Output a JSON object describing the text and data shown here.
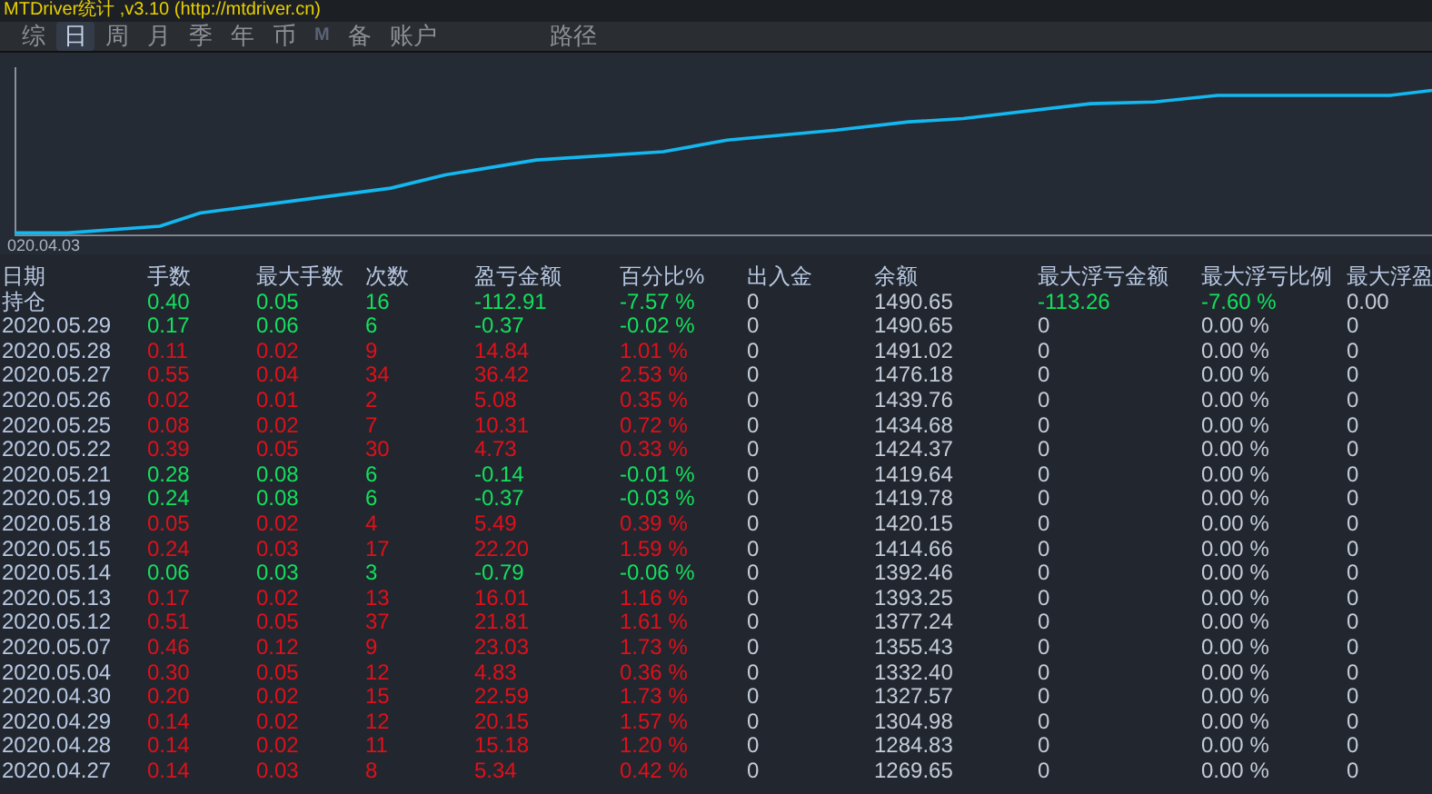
{
  "window": {
    "title": "MTDriver统计 ,v3.10 (http://mtdriver.cn)"
  },
  "tabs": [
    {
      "label": "综",
      "selected": false,
      "disabled": false
    },
    {
      "label": "日",
      "selected": true,
      "disabled": false
    },
    {
      "label": "周",
      "selected": false,
      "disabled": false
    },
    {
      "label": "月",
      "selected": false,
      "disabled": false
    },
    {
      "label": "季",
      "selected": false,
      "disabled": false
    },
    {
      "label": "年",
      "selected": false,
      "disabled": false
    },
    {
      "label": "币",
      "selected": false,
      "disabled": false
    },
    {
      "label": "M",
      "selected": false,
      "disabled": true
    },
    {
      "label": "备",
      "selected": false,
      "disabled": false
    },
    {
      "label": "账户",
      "selected": false,
      "disabled": false
    }
  ],
  "path_tab": {
    "label": "路径",
    "selected": false
  },
  "equity_chart": {
    "start_label": "020.04.03"
  },
  "table": {
    "columns": [
      "日期",
      "手数",
      "最大手数",
      "次数",
      "盈亏金额",
      "百分比%",
      "出入金",
      "余额",
      "最大浮亏金额",
      "最大浮亏比例",
      "最大浮盈"
    ],
    "rows": [
      {
        "kind": "loss",
        "float_tinted": true,
        "cells": [
          "持仓",
          "0.40",
          "0.05",
          "16",
          "-112.91",
          "-7.57 %",
          "0",
          "1490.65",
          "-113.26",
          "-7.60 %",
          "0.00"
        ]
      },
      {
        "kind": "loss",
        "float_tinted": false,
        "cells": [
          "2020.05.29",
          "0.17",
          "0.06",
          "6",
          "-0.37",
          "-0.02 %",
          "0",
          "1490.65",
          "0",
          "0.00 %",
          "0"
        ]
      },
      {
        "kind": "gain",
        "float_tinted": false,
        "cells": [
          "2020.05.28",
          "0.11",
          "0.02",
          "9",
          "14.84",
          "1.01 %",
          "0",
          "1491.02",
          "0",
          "0.00 %",
          "0"
        ]
      },
      {
        "kind": "gain",
        "float_tinted": false,
        "cells": [
          "2020.05.27",
          "0.55",
          "0.04",
          "34",
          "36.42",
          "2.53 %",
          "0",
          "1476.18",
          "0",
          "0.00 %",
          "0"
        ]
      },
      {
        "kind": "gain",
        "float_tinted": false,
        "cells": [
          "2020.05.26",
          "0.02",
          "0.01",
          "2",
          "5.08",
          "0.35 %",
          "0",
          "1439.76",
          "0",
          "0.00 %",
          "0"
        ]
      },
      {
        "kind": "gain",
        "float_tinted": false,
        "cells": [
          "2020.05.25",
          "0.08",
          "0.02",
          "7",
          "10.31",
          "0.72 %",
          "0",
          "1434.68",
          "0",
          "0.00 %",
          "0"
        ]
      },
      {
        "kind": "gain",
        "float_tinted": false,
        "cells": [
          "2020.05.22",
          "0.39",
          "0.05",
          "30",
          "4.73",
          "0.33 %",
          "0",
          "1424.37",
          "0",
          "0.00 %",
          "0"
        ]
      },
      {
        "kind": "loss",
        "float_tinted": false,
        "cells": [
          "2020.05.21",
          "0.28",
          "0.08",
          "6",
          "-0.14",
          "-0.01 %",
          "0",
          "1419.64",
          "0",
          "0.00 %",
          "0"
        ]
      },
      {
        "kind": "loss",
        "float_tinted": false,
        "cells": [
          "2020.05.19",
          "0.24",
          "0.08",
          "6",
          "-0.37",
          "-0.03 %",
          "0",
          "1419.78",
          "0",
          "0.00 %",
          "0"
        ]
      },
      {
        "kind": "gain",
        "float_tinted": false,
        "cells": [
          "2020.05.18",
          "0.05",
          "0.02",
          "4",
          "5.49",
          "0.39 %",
          "0",
          "1420.15",
          "0",
          "0.00 %",
          "0"
        ]
      },
      {
        "kind": "gain",
        "float_tinted": false,
        "cells": [
          "2020.05.15",
          "0.24",
          "0.03",
          "17",
          "22.20",
          "1.59 %",
          "0",
          "1414.66",
          "0",
          "0.00 %",
          "0"
        ]
      },
      {
        "kind": "loss",
        "float_tinted": false,
        "cells": [
          "2020.05.14",
          "0.06",
          "0.03",
          "3",
          "-0.79",
          "-0.06 %",
          "0",
          "1392.46",
          "0",
          "0.00 %",
          "0"
        ]
      },
      {
        "kind": "gain",
        "float_tinted": false,
        "cells": [
          "2020.05.13",
          "0.17",
          "0.02",
          "13",
          "16.01",
          "1.16 %",
          "0",
          "1393.25",
          "0",
          "0.00 %",
          "0"
        ]
      },
      {
        "kind": "gain",
        "float_tinted": false,
        "cells": [
          "2020.05.12",
          "0.51",
          "0.05",
          "37",
          "21.81",
          "1.61 %",
          "0",
          "1377.24",
          "0",
          "0.00 %",
          "0"
        ]
      },
      {
        "kind": "gain",
        "float_tinted": false,
        "cells": [
          "2020.05.07",
          "0.46",
          "0.12",
          "9",
          "23.03",
          "1.73 %",
          "0",
          "1355.43",
          "0",
          "0.00 %",
          "0"
        ]
      },
      {
        "kind": "gain",
        "float_tinted": false,
        "cells": [
          "2020.05.04",
          "0.30",
          "0.05",
          "12",
          "4.83",
          "0.36 %",
          "0",
          "1332.40",
          "0",
          "0.00 %",
          "0"
        ]
      },
      {
        "kind": "gain",
        "float_tinted": false,
        "cells": [
          "2020.04.30",
          "0.20",
          "0.02",
          "15",
          "22.59",
          "1.73 %",
          "0",
          "1327.57",
          "0",
          "0.00 %",
          "0"
        ]
      },
      {
        "kind": "gain",
        "float_tinted": false,
        "cells": [
          "2020.04.29",
          "0.14",
          "0.02",
          "12",
          "20.15",
          "1.57 %",
          "0",
          "1304.98",
          "0",
          "0.00 %",
          "0"
        ]
      },
      {
        "kind": "gain",
        "float_tinted": false,
        "cells": [
          "2020.04.28",
          "0.14",
          "0.02",
          "11",
          "15.18",
          "1.20 %",
          "0",
          "1284.83",
          "0",
          "0.00 %",
          "0"
        ]
      },
      {
        "kind": "gain",
        "float_tinted": false,
        "cells": [
          "2020.04.27",
          "0.14",
          "0.03",
          "8",
          "5.34",
          "0.42 %",
          "0",
          "1269.65",
          "0",
          "0.00 %",
          "0"
        ]
      }
    ]
  }
}
